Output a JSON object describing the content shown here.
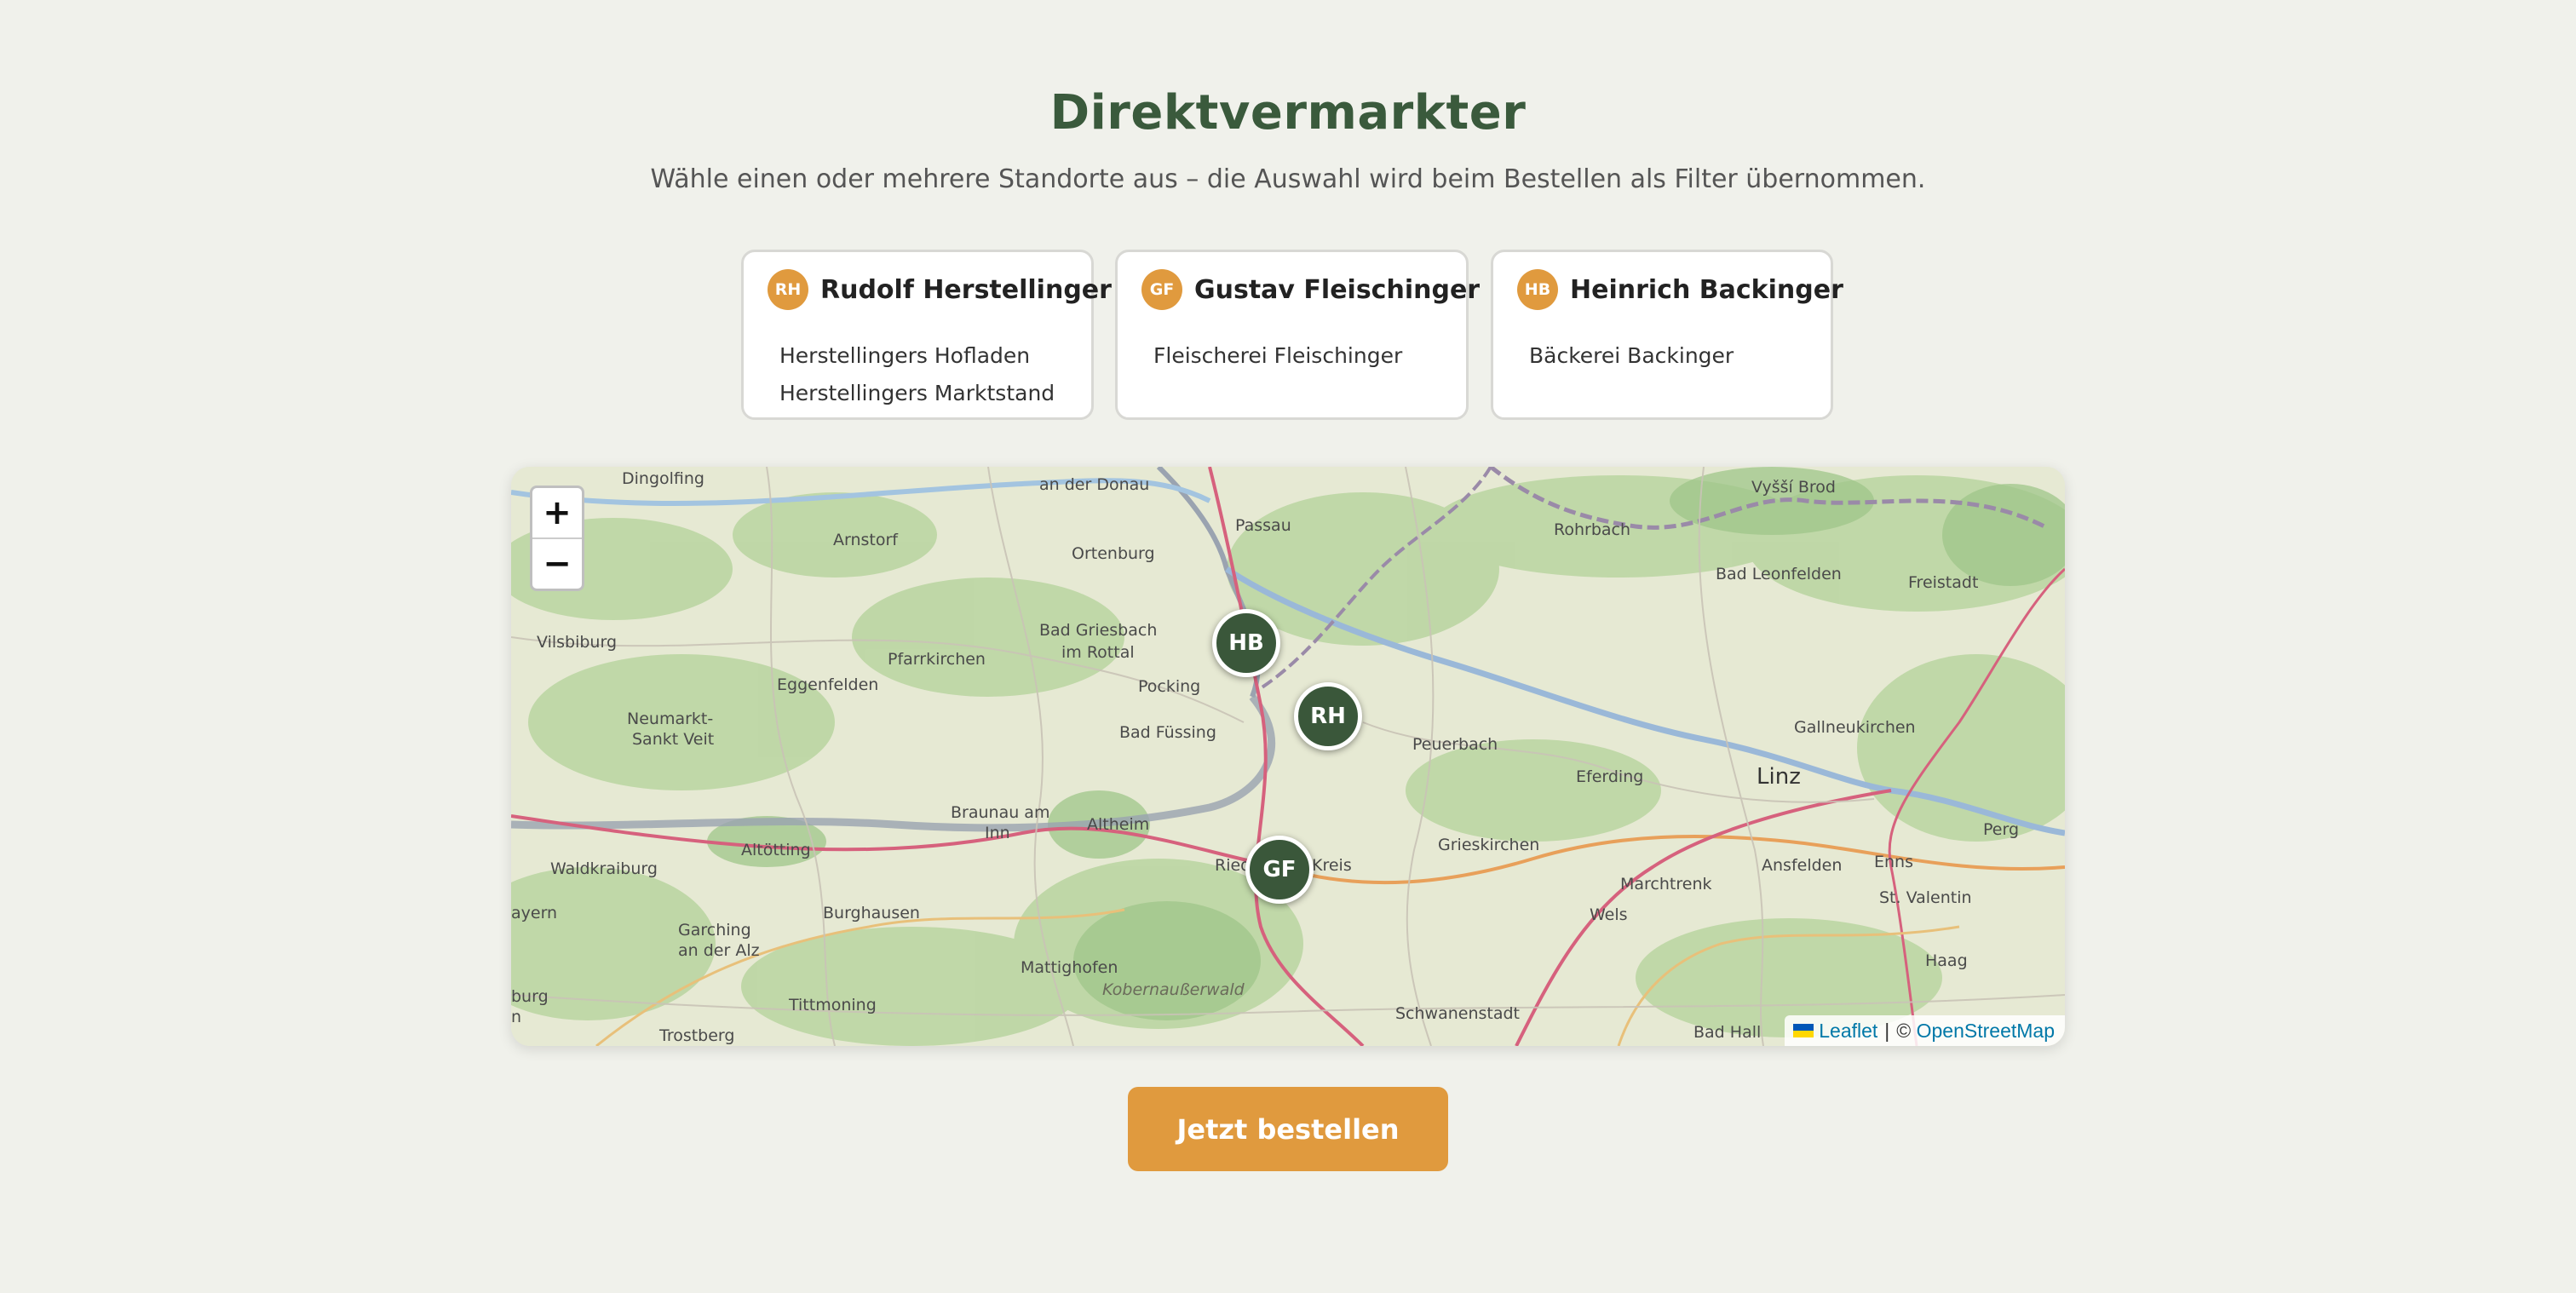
{
  "page": {
    "title": "Direktvermarkter",
    "subtitle": "Wähle einen oder mehrere Standorte aus – die Auswahl wird beim Bestellen als Filter übernommen."
  },
  "producers": [
    {
      "initials": "RH",
      "name": "Rudolf Herstellinger",
      "locations": [
        "Herstellingers Hofladen",
        "Herstellingers Marktstand"
      ]
    },
    {
      "initials": "GF",
      "name": "Gustav Fleischinger",
      "locations": [
        "Fleischerei Fleischinger"
      ]
    },
    {
      "initials": "HB",
      "name": "Heinrich Backinger",
      "locations": [
        "Bäckerei Backinger"
      ]
    }
  ],
  "map": {
    "zoom_in": "+",
    "zoom_out": "−",
    "markers": [
      "HB",
      "RH",
      "GF"
    ],
    "places": [
      "Dingolfing",
      "an der Donau",
      "Passau",
      "Rohrbach",
      "Vyšší Brod",
      "Arnstorf",
      "Ortenburg",
      "Bad Leonfelden",
      "Freistadt",
      "Vilsbiburg",
      "Bad Griesbach",
      "im Rottal",
      "Pfarrkirchen",
      "Eggenfelden",
      "Pocking",
      "Neumarkt-",
      "Sankt Veit",
      "Bad Füssing",
      "Peuerbach",
      "Gallneukirchen",
      "Eferding",
      "Linz",
      "Braunau am",
      "Inn",
      "Altheim",
      "Waldkraiburg",
      "Altötting",
      "Ried",
      "Kreis",
      "Grieskirchen",
      "Marchtrenk",
      "Ansfelden",
      "Enns",
      "Perg",
      "St. Valentin",
      "Burghausen",
      "Wels",
      "Haag",
      "Garching",
      "an der Alz",
      "Mattighofen",
      "Kobernaußerwald",
      "Tittmoning",
      "Schwanenstadt",
      "Trostberg",
      "Bad Hall",
      "ayern",
      "burg",
      "n"
    ],
    "attribution": {
      "leaflet": "Leaflet",
      "sep": "|",
      "copy": "©",
      "osm": "OpenStreetMap"
    }
  },
  "order_button": "Jetzt bestellen",
  "colors": {
    "accent": "#e09a3e",
    "brand_green": "#3a5a3c",
    "background": "#f0f1eb"
  }
}
